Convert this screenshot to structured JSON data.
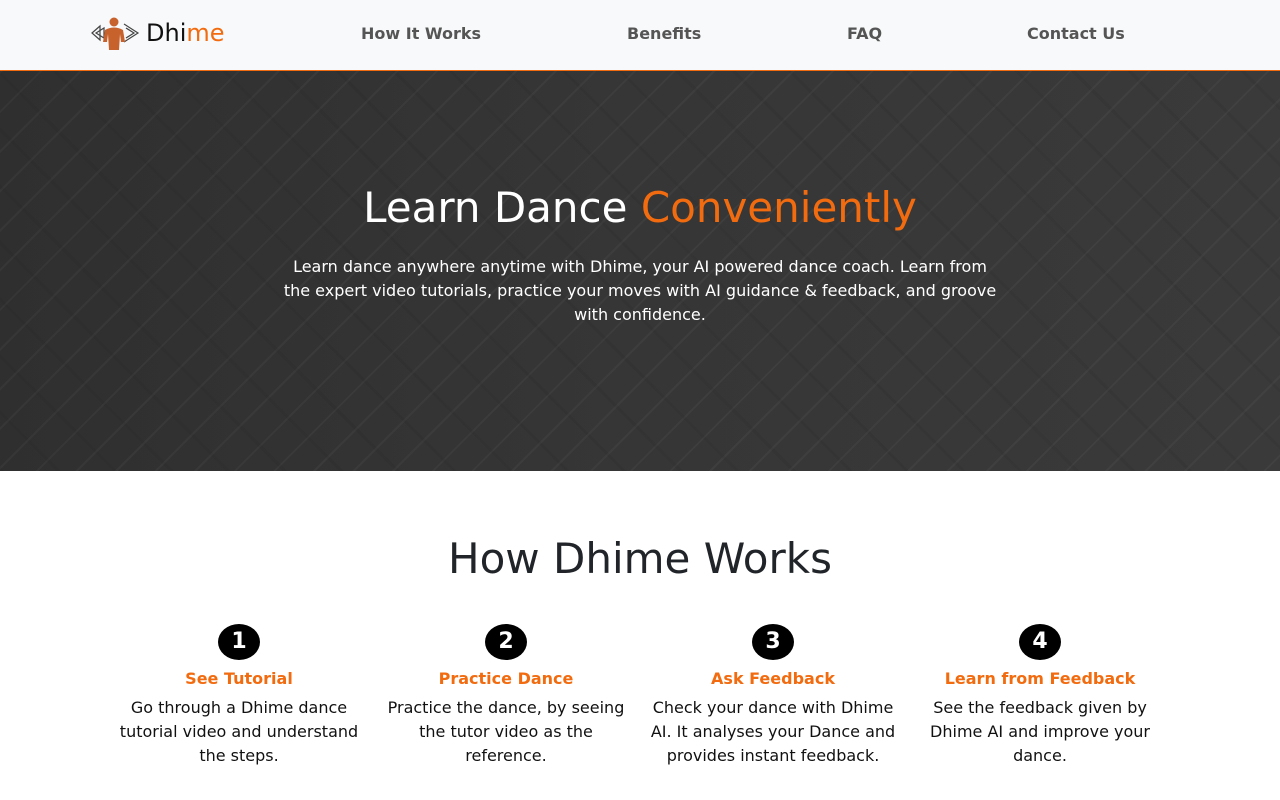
{
  "navbar": {
    "brand": {
      "part1": "Dhi",
      "part2": "me"
    },
    "links": [
      {
        "label": "How It Works"
      },
      {
        "label": "Benefits"
      },
      {
        "label": "FAQ"
      },
      {
        "label": "Contact Us"
      }
    ]
  },
  "hero": {
    "title_main": "Learn Dance ",
    "title_accent": "Conveniently",
    "description": "Learn dance anywhere anytime with Dhime, your AI powered dance coach. Learn from the expert video tutorials, practice your moves with AI guidance & feedback, and groove with confidence."
  },
  "how_it_works": {
    "title": "How Dhime Works",
    "steps": [
      {
        "number": "1",
        "title": "See Tutorial",
        "text": "Go through a Dhime dance tutorial video and understand the steps."
      },
      {
        "number": "2",
        "title": "Practice Dance",
        "text": "Practice the dance, by seeing the tutor video as the reference."
      },
      {
        "number": "3",
        "title": "Ask Feedback",
        "text": "Check your dance with Dhime AI. It analyses your Dance and provides instant feedback."
      },
      {
        "number": "4",
        "title": "Learn from Feedback",
        "text": "See the feedback given by Dhime AI and improve your dance."
      }
    ]
  },
  "colors": {
    "accent": "#f26b0f",
    "hero_bg": "#333333",
    "navbar_bg": "#f8f9fa"
  },
  "icons": {
    "logo": "dancer-silhouette-icon"
  }
}
